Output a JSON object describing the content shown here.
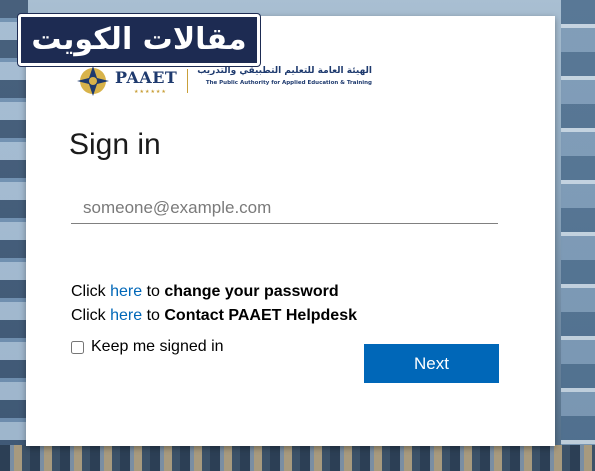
{
  "watermark": {
    "text": "مقالات الكويت"
  },
  "logo": {
    "brand": "PAAET",
    "arabic_name": "الهيئة العامة للتعليم التطبيقي والتدريب",
    "english_name": "The Public Authority for Applied Education & Training"
  },
  "signin": {
    "title": "Sign in",
    "email_placeholder": "someone@example.com",
    "email_value": "",
    "line1": {
      "prefix": "Click ",
      "link": "here",
      "middle": " to ",
      "bold": "change your password"
    },
    "line2": {
      "prefix": "Click ",
      "link": "here",
      "middle": " to ",
      "bold": "Contact PAAET Helpdesk"
    },
    "keep_signed_in_label": "Keep me signed in",
    "keep_signed_in_checked": false,
    "next_label": "Next"
  },
  "colors": {
    "accent": "#0067b8",
    "brand_navy": "#1e3a6e",
    "watermark_bg": "#1d2b52"
  }
}
